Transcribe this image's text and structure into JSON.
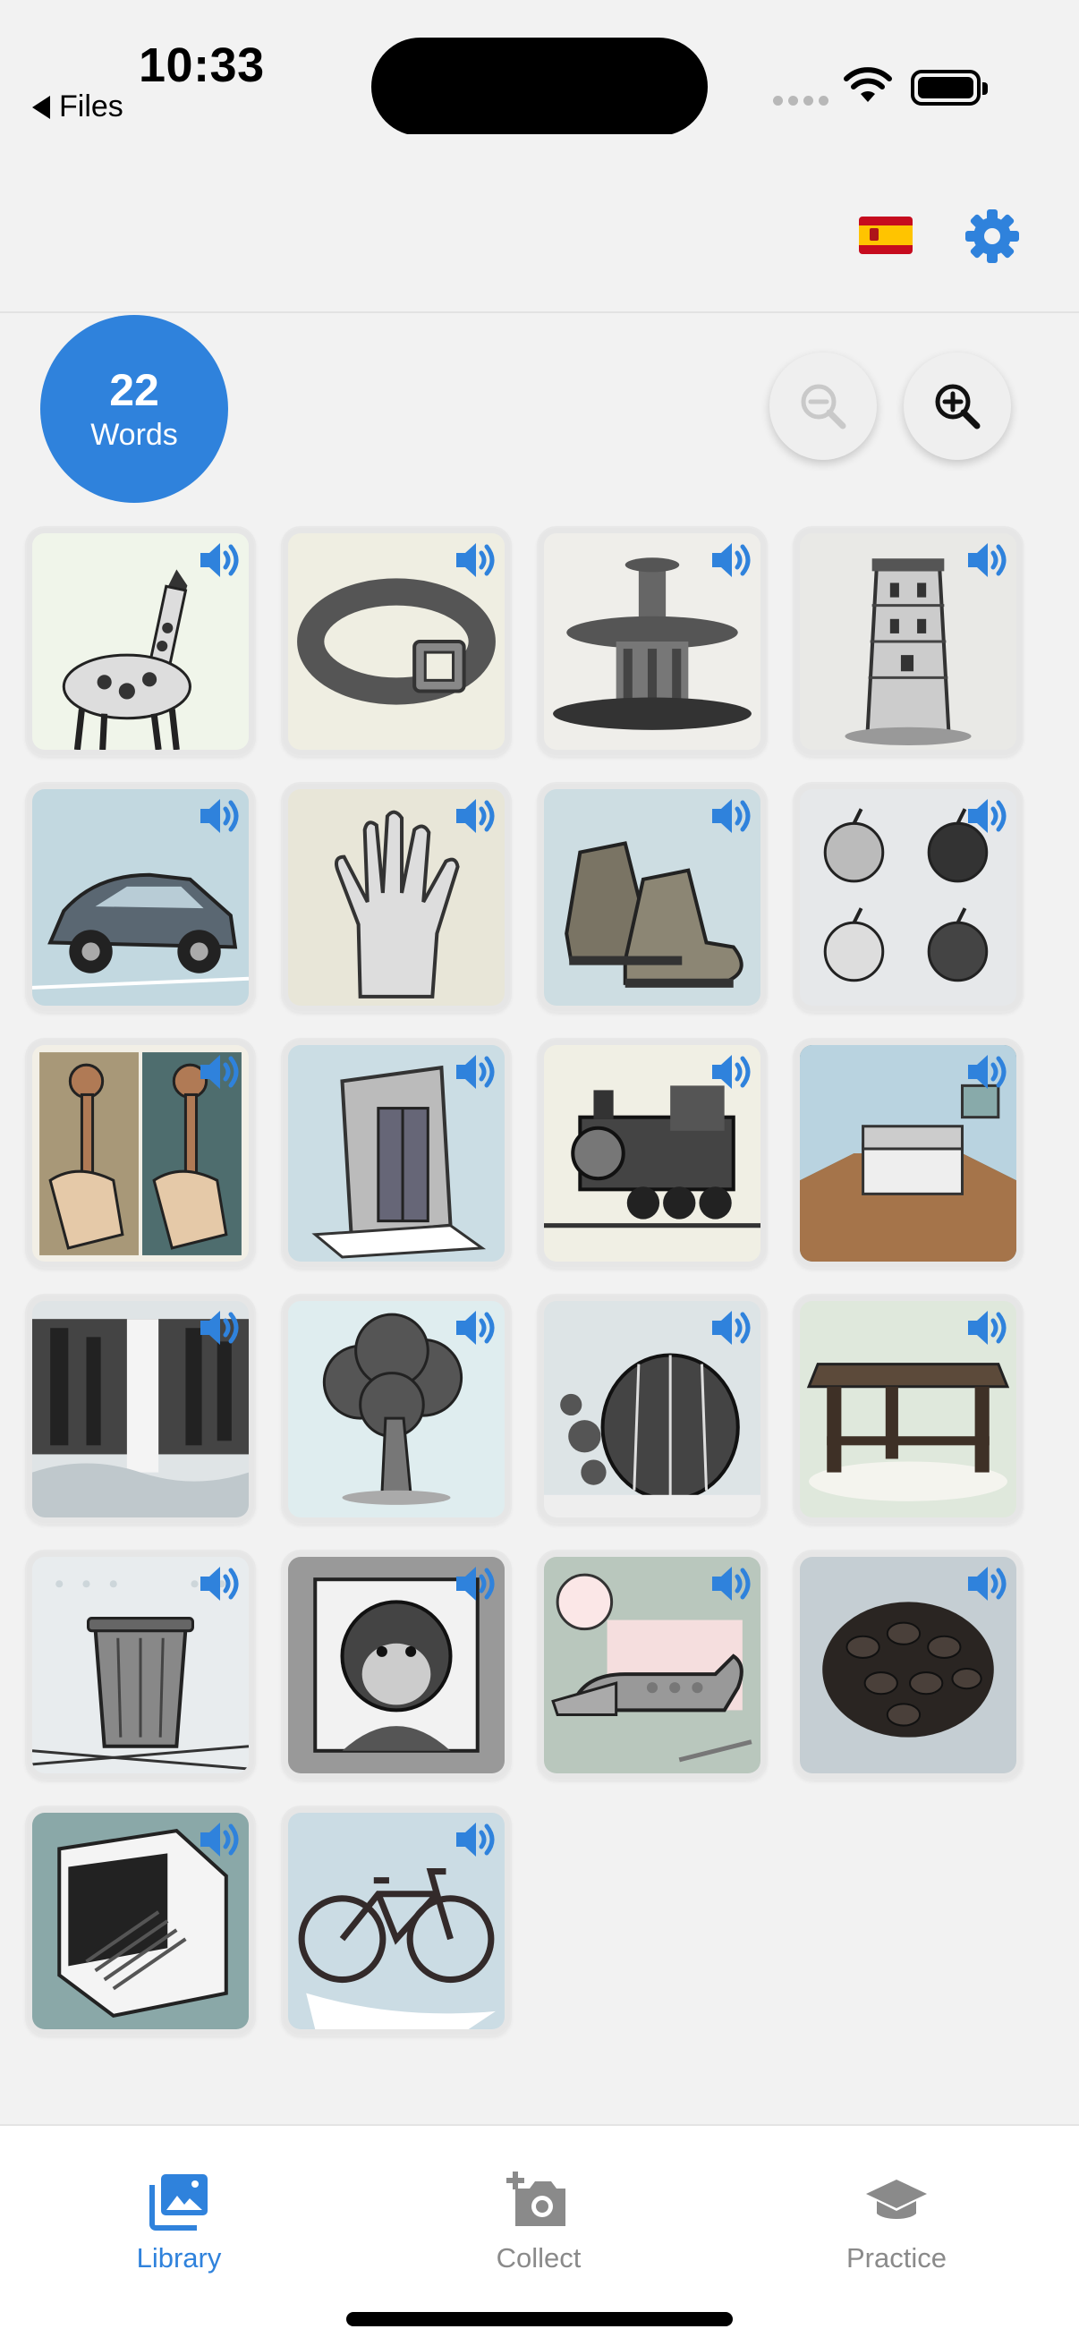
{
  "status_bar": {
    "time": "10:33",
    "back_label": "Files"
  },
  "header": {
    "language_flag": "spain-flag",
    "settings_icon": "gear-icon"
  },
  "toolbar": {
    "word_count": "22",
    "word_count_label": "Words",
    "zoom_out_icon": "zoom-out-icon",
    "zoom_in_icon": "zoom-in-icon",
    "zoom_out_enabled": false
  },
  "library": {
    "items": [
      {
        "picture": "giraffe"
      },
      {
        "picture": "belt"
      },
      {
        "picture": "fountain"
      },
      {
        "picture": "tower"
      },
      {
        "picture": "car"
      },
      {
        "picture": "hand"
      },
      {
        "picture": "boots"
      },
      {
        "picture": "apples"
      },
      {
        "picture": "keys"
      },
      {
        "picture": "elevator"
      },
      {
        "picture": "train"
      },
      {
        "picture": "bedroom"
      },
      {
        "picture": "waterfall"
      },
      {
        "picture": "tree"
      },
      {
        "picture": "cactus"
      },
      {
        "picture": "table"
      },
      {
        "picture": "trash-can"
      },
      {
        "picture": "monkey"
      },
      {
        "picture": "crocodile"
      },
      {
        "picture": "coffee-beans"
      },
      {
        "picture": "stairs"
      },
      {
        "picture": "bicycle"
      }
    ],
    "speaker_icon": "speaker-icon"
  },
  "tab_bar": {
    "tabs": [
      {
        "label": "Library",
        "icon": "photo-library-icon",
        "active": true
      },
      {
        "label": "Collect",
        "icon": "add-photo-icon",
        "active": false
      },
      {
        "label": "Practice",
        "icon": "graduation-cap-icon",
        "active": false
      }
    ]
  },
  "colors": {
    "accent": "#2f82dc",
    "background": "#f2f2f2",
    "inactive_tab": "#8a8a8a"
  }
}
